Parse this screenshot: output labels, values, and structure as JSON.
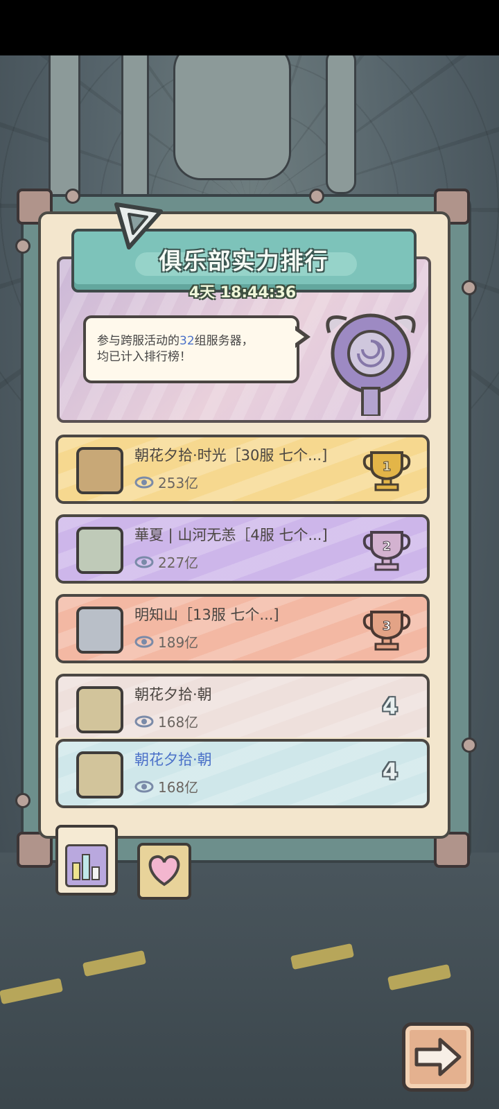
{
  "header": {
    "title": "俱乐部实力排行",
    "countdown": "4天 18:44:36"
  },
  "info_bubble": {
    "prefix": "参与跨服活动的",
    "server_count": "32",
    "suffix_line1": "组服务器，",
    "line2": "均已计入排行榜！"
  },
  "rankings": [
    {
      "name": "朝花夕拾·时光［30服 七个...]",
      "power": "253亿",
      "rank": "1",
      "name_color": "#4a4541"
    },
    {
      "name": "華夏 | 山河无恙［4服 七个...]",
      "power": "227亿",
      "rank": "2",
      "name_color": "#4a4541"
    },
    {
      "name": "明知山［13服 七个...]",
      "power": "189亿",
      "rank": "3",
      "name_color": "#4a4541"
    },
    {
      "name": "朝花夕拾·朝",
      "power": "168亿",
      "rank": "4",
      "name_color": "#4a4541"
    },
    {
      "name": "朝花夕拾·朝",
      "power": "168亿",
      "rank": "4",
      "name_color": "#4a70c8"
    }
  ],
  "colors": {
    "row1": "#f6d88f",
    "row2": "#cdb6ea",
    "row3": "#f3b8a3",
    "row4": "#eee0dc",
    "row5": "#cfe7ea",
    "gold": "#d9a53a",
    "silver": "#c6a7c4",
    "bronze": "#d99878"
  },
  "icons": {
    "tab_ranking": "bar-chart-icon",
    "tab_favorite": "heart-icon",
    "next": "arrow-right-icon",
    "views": "eye-icon",
    "pin": "triangle-pin-icon"
  }
}
